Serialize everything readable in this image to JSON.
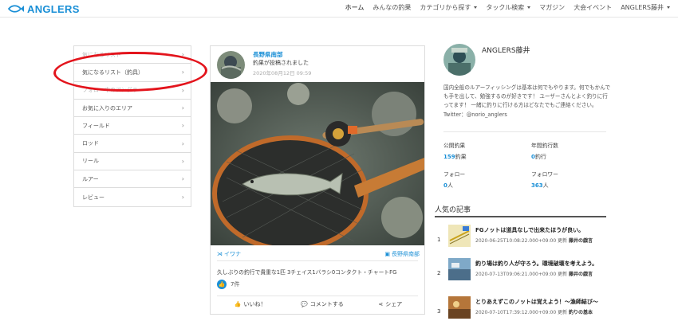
{
  "brand": {
    "name": "ANGLERS",
    "color": "#1a8fd6"
  },
  "nav": [
    {
      "label": "ホーム",
      "dropdown": false,
      "active": true
    },
    {
      "label": "みんなの釣果",
      "dropdown": false
    },
    {
      "label": "カテゴリから探す",
      "dropdown": true
    },
    {
      "label": "タックル検索",
      "dropdown": true
    },
    {
      "label": "マガジン",
      "dropdown": false
    },
    {
      "label": "大会イベント",
      "dropdown": false
    },
    {
      "label": "ANGLERS藤井",
      "dropdown": true
    }
  ],
  "menu": {
    "items": [
      {
        "label": "気になるリスト"
      },
      {
        "label": "気になるリスト（釣具）"
      },
      {
        "label": "フォロー中のアングラー"
      },
      {
        "label": "お気に入りのエリア"
      },
      {
        "label": "フィールド"
      },
      {
        "label": "ロッド"
      },
      {
        "label": "リール"
      },
      {
        "label": "ルアー"
      },
      {
        "label": "レビュー"
      }
    ]
  },
  "post": {
    "author": "長野県南部",
    "action": "釣果が投稿されました",
    "date": "2020年08月12日 09:59",
    "species": "イワナ",
    "area": "長野県南部",
    "body": "久しぶりの釣行で貴重な1匹 3チェイス1バラシ0コンタクト・チャートFG",
    "likes": "7件",
    "like_label": "いいね！",
    "comment_label": "コメントする",
    "share_label": "シェア"
  },
  "profile": {
    "name": "ANGLERS藤井",
    "bio": "国内全般のルアーフィッシングは基本は何でもやります。何でもかんでも手を出して、勉強するのが好きです！ ユーザーさんとよく釣りに行ってます！ 一緒に釣りに行ける方はどなたでもご連絡ください。 Twitter：@norio_anglers",
    "stats": [
      {
        "label": "公開釣果",
        "value": "159",
        "unit": "釣果"
      },
      {
        "label": "年間釣行数",
        "value": "0",
        "unit": "釣行"
      },
      {
        "label": "フォロー",
        "value": "0",
        "unit": "人"
      },
      {
        "label": "フォロワー",
        "value": "363",
        "unit": "人"
      }
    ]
  },
  "popular": {
    "title": "人気の記事",
    "items": [
      {
        "rank": "1",
        "title": "FGノットは道具なしで出来たほうが良い。",
        "date": "2020-06-25T10:08:22.000+09:00",
        "updated": "更新",
        "author": "藤井の戯言"
      },
      {
        "rank": "2",
        "title": "釣り場は釣り人が守ろう。環境破壊を考えよう。",
        "date": "2020-07-13T09:06:21.000+09:00",
        "updated": "更新",
        "author": "藤井の戯言"
      },
      {
        "rank": "3",
        "title": "とりあえずこのノットは覚えよう！〜漁師結び〜",
        "date": "2020-07-10T17:39:12.000+09:00",
        "updated": "更新",
        "author": "釣りの基本"
      }
    ]
  },
  "annotation_color": "#e3141c"
}
